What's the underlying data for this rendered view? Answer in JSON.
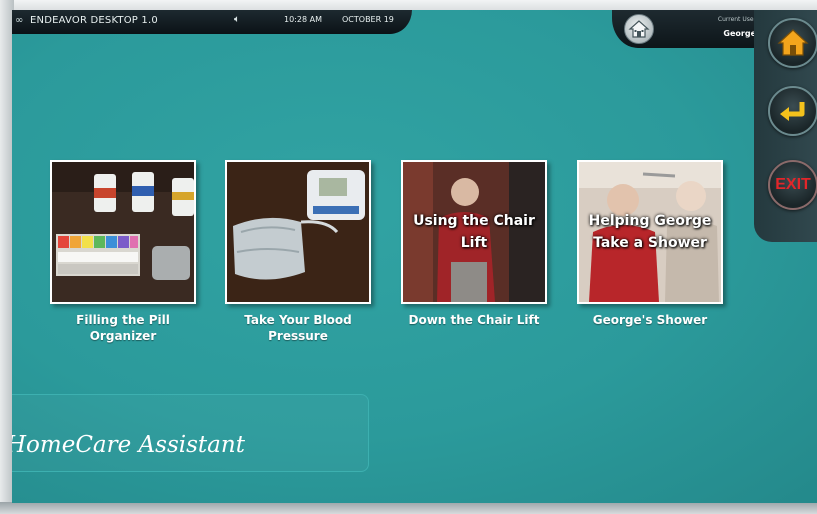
{
  "topbar": {
    "link_icon": "link-icon",
    "title": "ENDEAVOR DESKTOP 1.0",
    "speaker_icon": "speaker-icon",
    "time": "10:28 AM",
    "date": "OCTOBER 19"
  },
  "user": {
    "label": "Current User",
    "name": "George",
    "avatar_icon": "house-avatar-icon"
  },
  "side_nav": {
    "home_icon": "home-icon",
    "back_icon": "back-arrow-icon",
    "exit_label": "EXIT"
  },
  "tiles": [
    {
      "label": "Filling the Pill Organizer",
      "overlay": ""
    },
    {
      "label": "Take Your Blood Pressure",
      "overlay": ""
    },
    {
      "label": "Down the Chair Lift",
      "overlay": "Using the Chair Lift"
    },
    {
      "label": "George's Shower",
      "overlay": "Helping George Take a Shower"
    }
  ],
  "brand": {
    "text": "HomeCare Assistant"
  },
  "colors": {
    "background": "#2b9a9b",
    "bar": "#0f181c",
    "accent_home": "#f4a51c",
    "accent_back": "#f4c21c",
    "exit": "#e2262a"
  }
}
